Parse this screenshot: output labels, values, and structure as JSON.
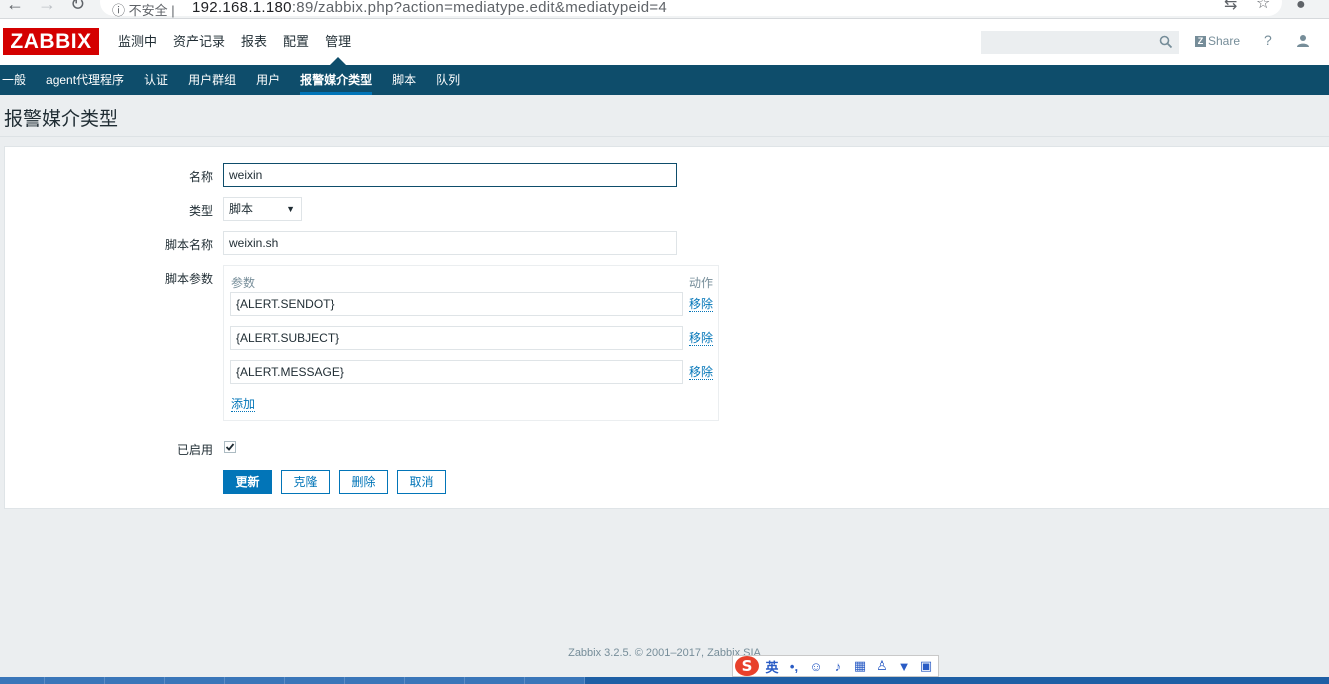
{
  "browser": {
    "security_label": "ⓘ  不安全 |",
    "url_host": "192.168.1.180",
    "url_rest": ":89/zabbix.php?action=mediatype.edit&mediatypeid=4"
  },
  "header": {
    "logo": "ZABBIX",
    "nav": [
      "监测中",
      "资产记录",
      "报表",
      "配置",
      "管理"
    ],
    "active_nav": "管理",
    "share_label": "Share",
    "help_label": "?"
  },
  "subnav": {
    "items": [
      "一般",
      "agent代理程序",
      "认证",
      "用户群组",
      "用户",
      "报警媒介类型",
      "脚本",
      "队列"
    ],
    "active": "报警媒介类型"
  },
  "page": {
    "title": "报警媒介类型"
  },
  "form": {
    "name_label": "名称",
    "name_value": "weixin",
    "type_label": "类型",
    "type_value": "脚本",
    "script_name_label": "脚本名称",
    "script_name_value": "weixin.sh",
    "script_params_label": "脚本参数",
    "params_col_header": "参数",
    "action_col_header": "动作",
    "params": [
      "{ALERT.SENDOT}",
      "{ALERT.SUBJECT}",
      "{ALERT.MESSAGE}"
    ],
    "remove_label": "移除",
    "add_label": "添加",
    "enabled_label": "已启用",
    "enabled": true,
    "buttons": {
      "update": "更新",
      "clone": "克隆",
      "delete": "删除",
      "cancel": "取消"
    }
  },
  "footer": {
    "text": "Zabbix 3.2.5. © 2001–2017, Zabbix SIA"
  },
  "ime": {
    "brand": "S",
    "mode": "英",
    "punct": "•,"
  },
  "colors": {
    "brand_red": "#d40000",
    "subnav_bg": "#0e4d6b",
    "accent": "#0275b8"
  }
}
